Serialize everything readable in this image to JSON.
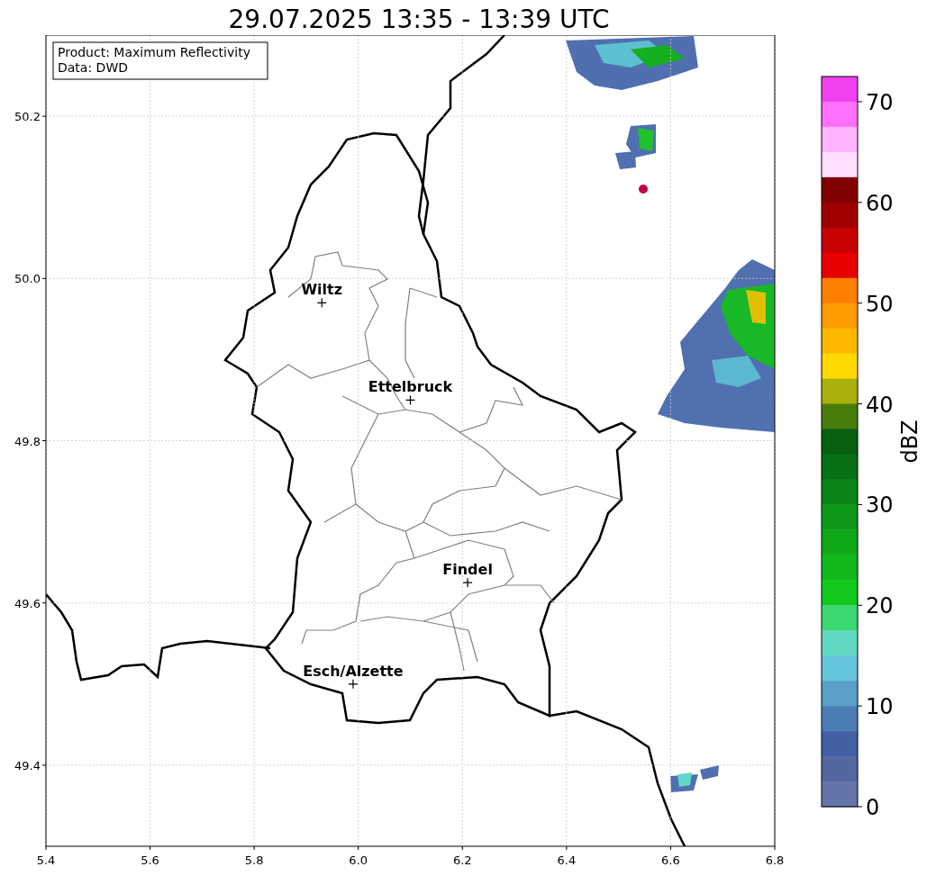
{
  "title": "29.07.2025 13:35 - 13:39 UTC",
  "info_box": [
    "Product: Maximum Reflectivity",
    "Data: DWD"
  ],
  "map": {
    "x_ticks": [
      "5.4",
      "5.6",
      "5.8",
      "6.0",
      "6.2",
      "6.4",
      "6.6",
      "6.8"
    ],
    "y_ticks": [
      "50.2",
      "50.0",
      "49.8",
      "49.6",
      "49.4"
    ],
    "cities": [
      {
        "name": "Wiltz"
      },
      {
        "name": "Ettelbruck"
      },
      {
        "name": "Findel"
      },
      {
        "name": "Esch/Alzette"
      }
    ]
  },
  "colorbar": {
    "label": "dBZ",
    "ticks": [
      "70",
      "60",
      "50",
      "40",
      "30",
      "20",
      "10",
      "0"
    ],
    "segments": [
      {
        "color": "#f040f0"
      },
      {
        "color": "#ff70ff"
      },
      {
        "color": "#ffb4ff"
      },
      {
        "color": "#ffe0ff"
      },
      {
        "color": "#800000"
      },
      {
        "color": "#a00000"
      },
      {
        "color": "#c80000"
      },
      {
        "color": "#e80000"
      },
      {
        "color": "#ff8000"
      },
      {
        "color": "#ff9c00"
      },
      {
        "color": "#ffb800"
      },
      {
        "color": "#ffd800"
      },
      {
        "color": "#aab00c"
      },
      {
        "color": "#4a7c0c"
      },
      {
        "color": "#066010"
      },
      {
        "color": "#087014"
      },
      {
        "color": "#0a8416"
      },
      {
        "color": "#0c9818"
      },
      {
        "color": "#0ea818"
      },
      {
        "color": "#10b81c"
      },
      {
        "color": "#12c81c"
      },
      {
        "color": "#3cd870"
      },
      {
        "color": "#60d8c0"
      },
      {
        "color": "#64c4dc"
      },
      {
        "color": "#5aa0c8"
      },
      {
        "color": "#4c7cb4"
      },
      {
        "color": "#4460a4"
      },
      {
        "color": "#5466a0"
      },
      {
        "color": "#6474a8"
      }
    ]
  }
}
